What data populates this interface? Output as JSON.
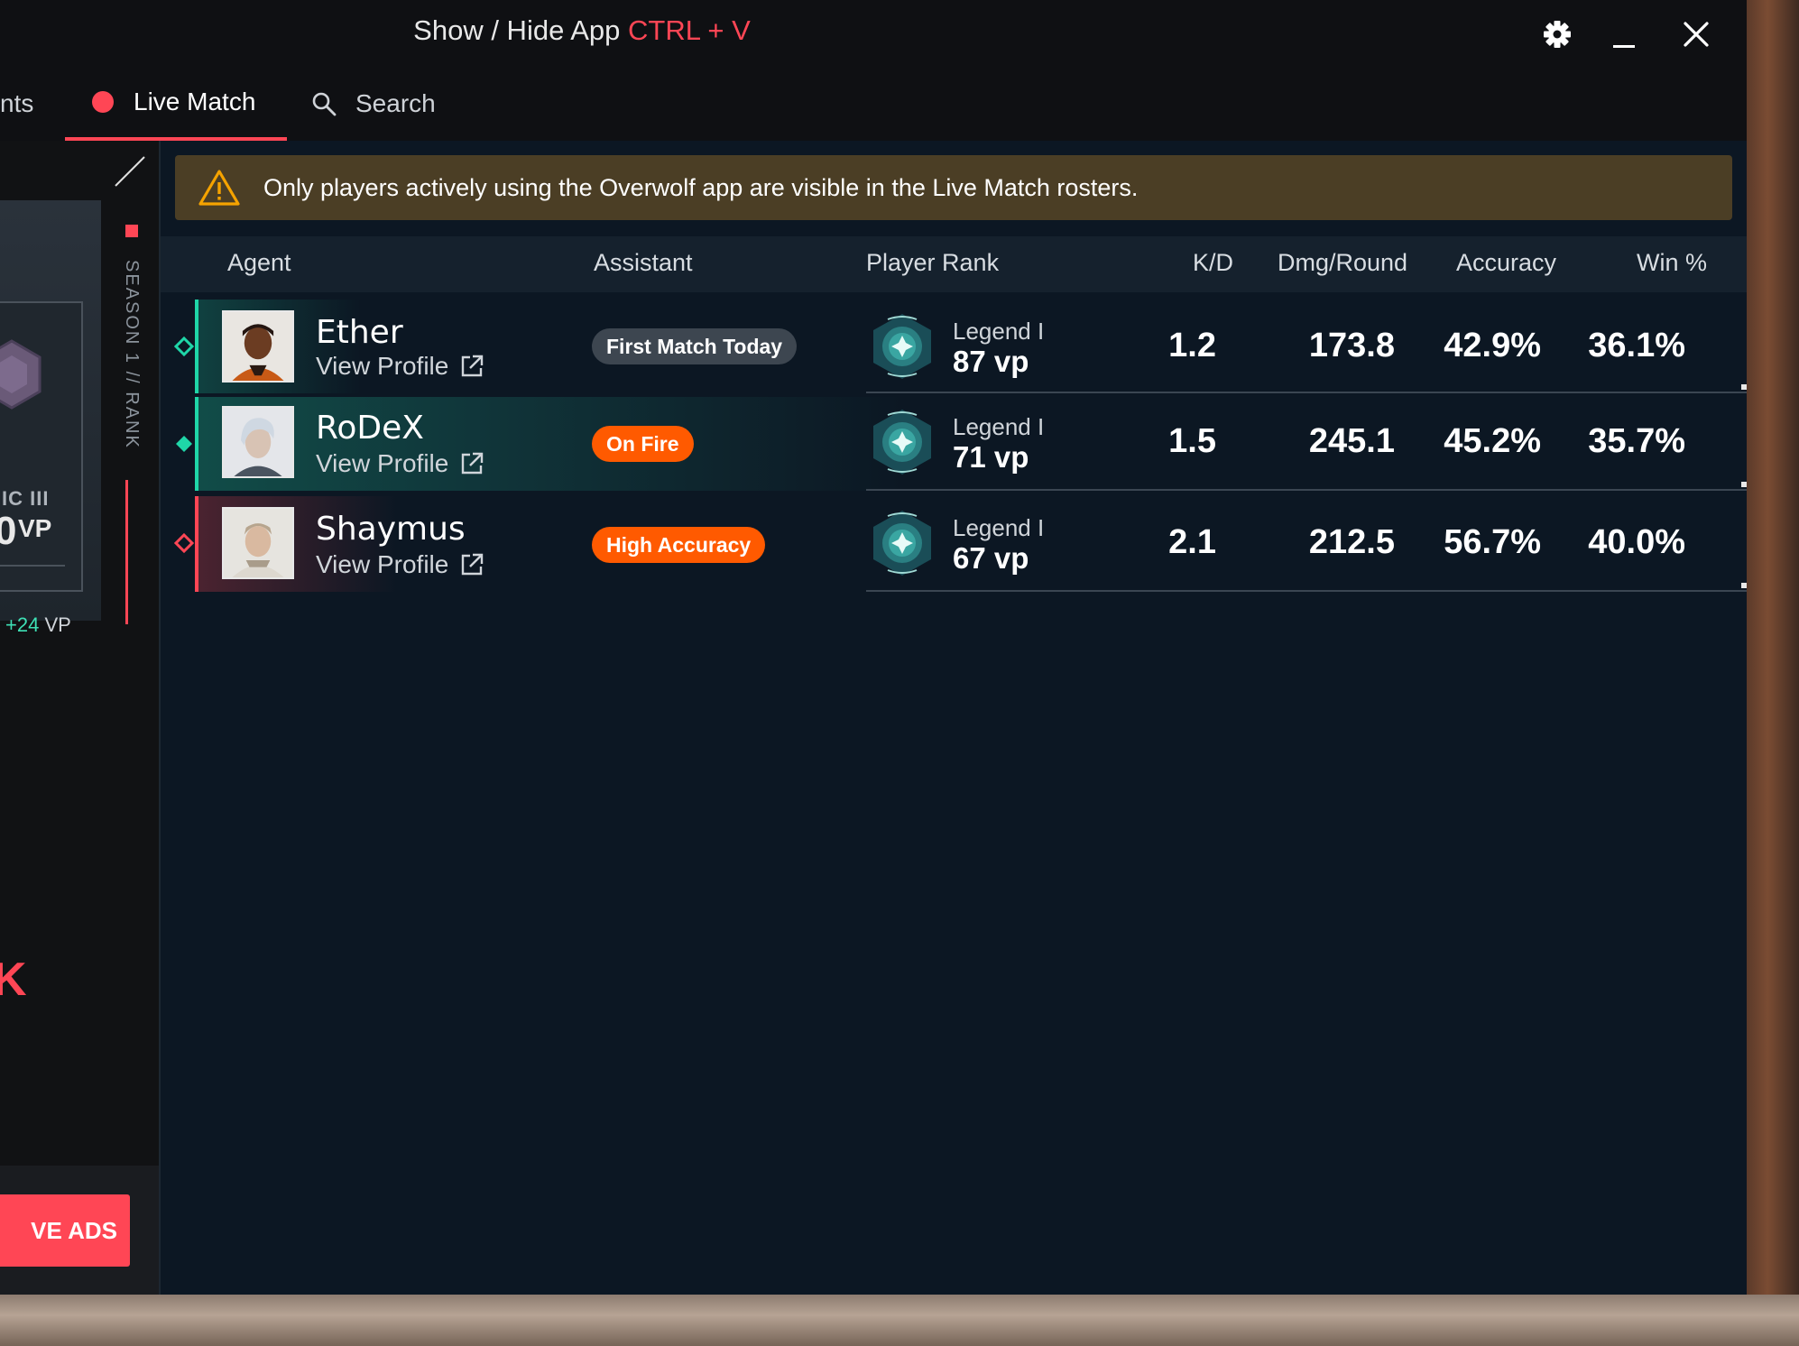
{
  "window": {
    "title_prefix": "Show / Hide App",
    "title_hotkey": "CTRL + V"
  },
  "tabs": {
    "events_partial": "nts",
    "live_match": "Live Match",
    "search": "Search"
  },
  "side_panel": {
    "rank_partial": "IC III",
    "vp_partial": "0",
    "vp_unit": "VP",
    "vp_gain": "+24",
    "vp_gain_unit": "VP",
    "season_label": "SEASON 1 // RANK",
    "x_partial": "K",
    "ads_button": "VE ADS"
  },
  "banner": {
    "text": "Only players actively using the Overwolf app are visible in the Live Match rosters.",
    "icon": "warning-icon"
  },
  "table": {
    "columns": {
      "agent": "Agent",
      "assistant": "Assistant",
      "player_rank": "Player Rank",
      "kd": "K/D",
      "dmg_round": "Dmg/Round",
      "accuracy": "Accuracy",
      "win_pct": "Win %"
    },
    "view_profile_label": "View Profile",
    "rows": [
      {
        "name": "Ether",
        "badge": "First Match Today",
        "rank": "Legend I",
        "vp": "87 vp",
        "kd": "1.2",
        "dmg": "173.8",
        "accuracy": "42.9%",
        "win": "36.1%"
      },
      {
        "name": "RoDeX",
        "badge": "On Fire",
        "rank": "Legend I",
        "vp": "71 vp",
        "kd": "1.5",
        "dmg": "245.1",
        "accuracy": "45.2%",
        "win": "35.7%"
      },
      {
        "name": "Shaymus",
        "badge": "High Accuracy",
        "rank": "Legend I",
        "vp": "67 vp",
        "kd": "2.1",
        "dmg": "212.5",
        "accuracy": "56.7%",
        "win": "40.0%"
      }
    ]
  },
  "colors": {
    "accent_red": "#ff4655",
    "team_green": "#1fd6a8",
    "badge_orange": "#ff5a00",
    "banner_bg": "#4b3e25"
  }
}
